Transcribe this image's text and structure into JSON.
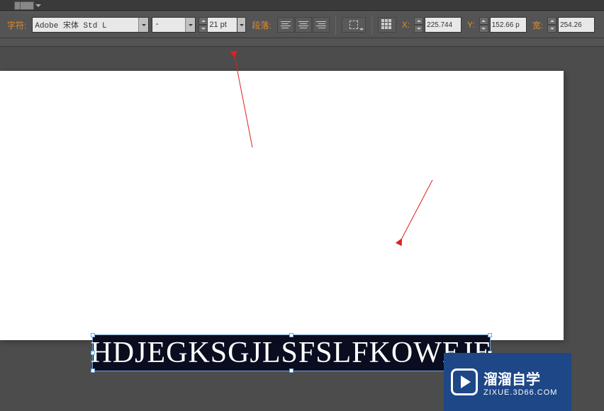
{
  "toolbar": {
    "char_label": "字符:",
    "font_family": "Adobe 宋体 Std L",
    "font_weight": "-",
    "font_size": "21 pt",
    "para_label": "段落:"
  },
  "transform": {
    "x_label": "X:",
    "x_value": "225.744",
    "y_label": "Y:",
    "y_value": "152.66 p",
    "w_label": "宽:",
    "w_value": "254.26"
  },
  "document": {
    "text_content": "HDJEGKSGJLSFSLFKOWEJE"
  },
  "watermark": {
    "title": "溜溜自学",
    "url": "ZIXUE.3D66.COM"
  }
}
